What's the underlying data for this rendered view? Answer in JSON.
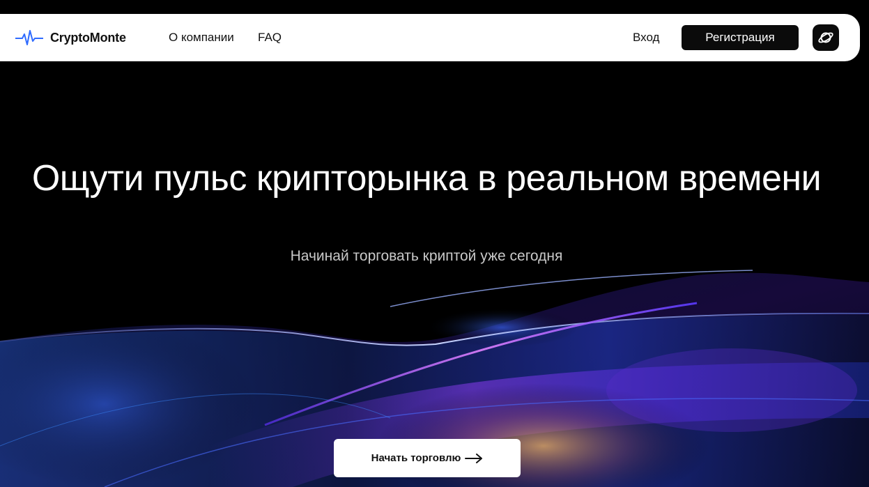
{
  "header": {
    "brand": "CryptoMonte",
    "nav": {
      "about": "О компании",
      "faq": "FAQ"
    },
    "login": "Вход",
    "register": "Регистрация",
    "language_icon": "planet-icon"
  },
  "hero": {
    "title": "Ощути пульс крипторынка в реальном времени",
    "subtitle": "Начинай торговать криптой уже сегодня",
    "cta_label": "Начать торговлю",
    "cta_icon": "arrow-right-icon"
  },
  "colors": {
    "background": "#000000",
    "navbar": "#ffffff",
    "brand_accent": "#2f6bff",
    "dark_button": "#0b0b0b"
  }
}
